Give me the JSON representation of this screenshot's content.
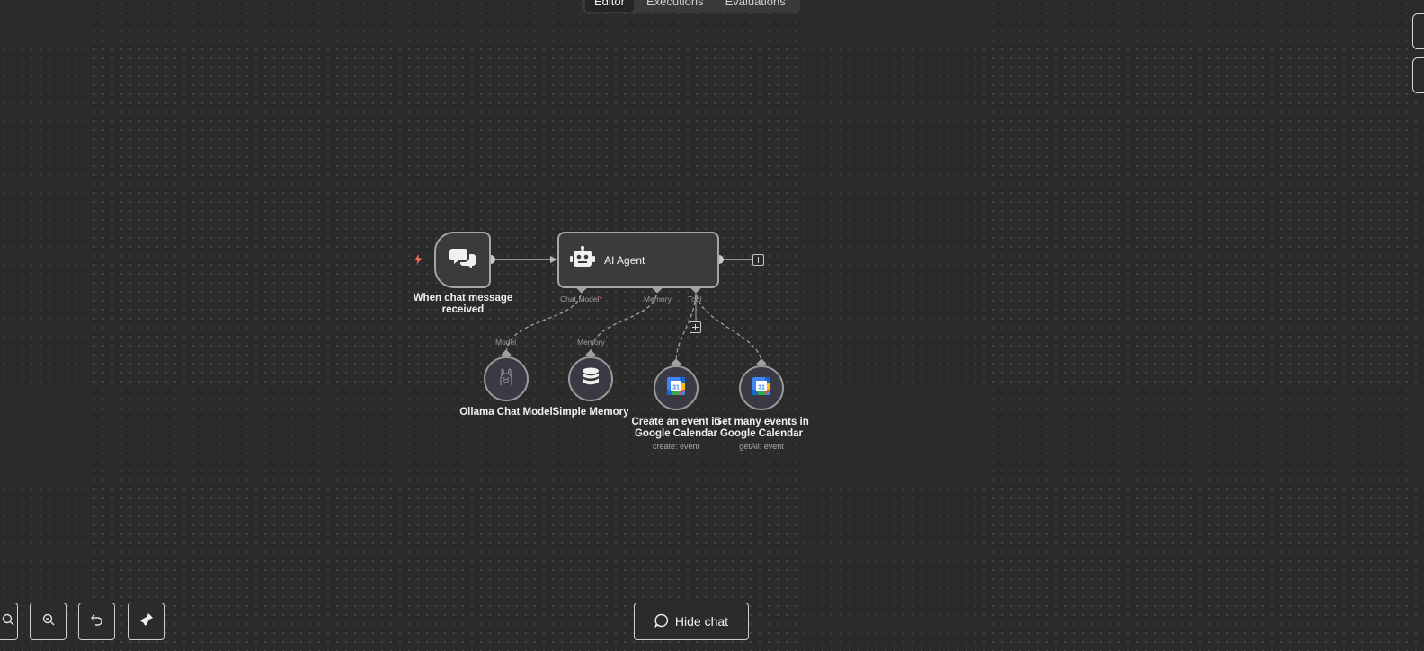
{
  "tabs": [
    {
      "label": "Editor",
      "active": true
    },
    {
      "label": "Executions",
      "active": false
    },
    {
      "label": "Evaluations",
      "active": false
    }
  ],
  "nodes": {
    "trigger": {
      "title": "When chat message received",
      "line1": "When chat message",
      "line2": "received",
      "icon": "chat-bubbles-icon"
    },
    "agent": {
      "title": "AI Agent",
      "icon": "robot-icon"
    },
    "ollama": {
      "title": "Ollama Chat Model",
      "icon": "llama-icon"
    },
    "memory": {
      "title": "Simple Memory",
      "icon": "database-icon"
    },
    "create_event": {
      "line1": "Create an event in",
      "line2": "Google Calendar",
      "subtitle": "create: event",
      "icon": "google-calendar-icon"
    },
    "get_events": {
      "line1": "Get many events in",
      "line2": "Google Calendar",
      "subtitle": "getAll: event",
      "icon": "google-calendar-icon"
    }
  },
  "ports": {
    "chat_model": "Chat Model",
    "chat_model_required": "*",
    "memory": "Memory",
    "tool": "Tool",
    "model": "Model",
    "memory_in": "Memory"
  },
  "controls": {
    "hide_chat": "Hide chat"
  },
  "colors": {
    "canvas": "#2b2b2b",
    "node_fill": "#3b3b3b",
    "node_border": "#a6a6a6",
    "trigger_bolt": "#ff6d5a",
    "required": "#ff6b6b"
  }
}
